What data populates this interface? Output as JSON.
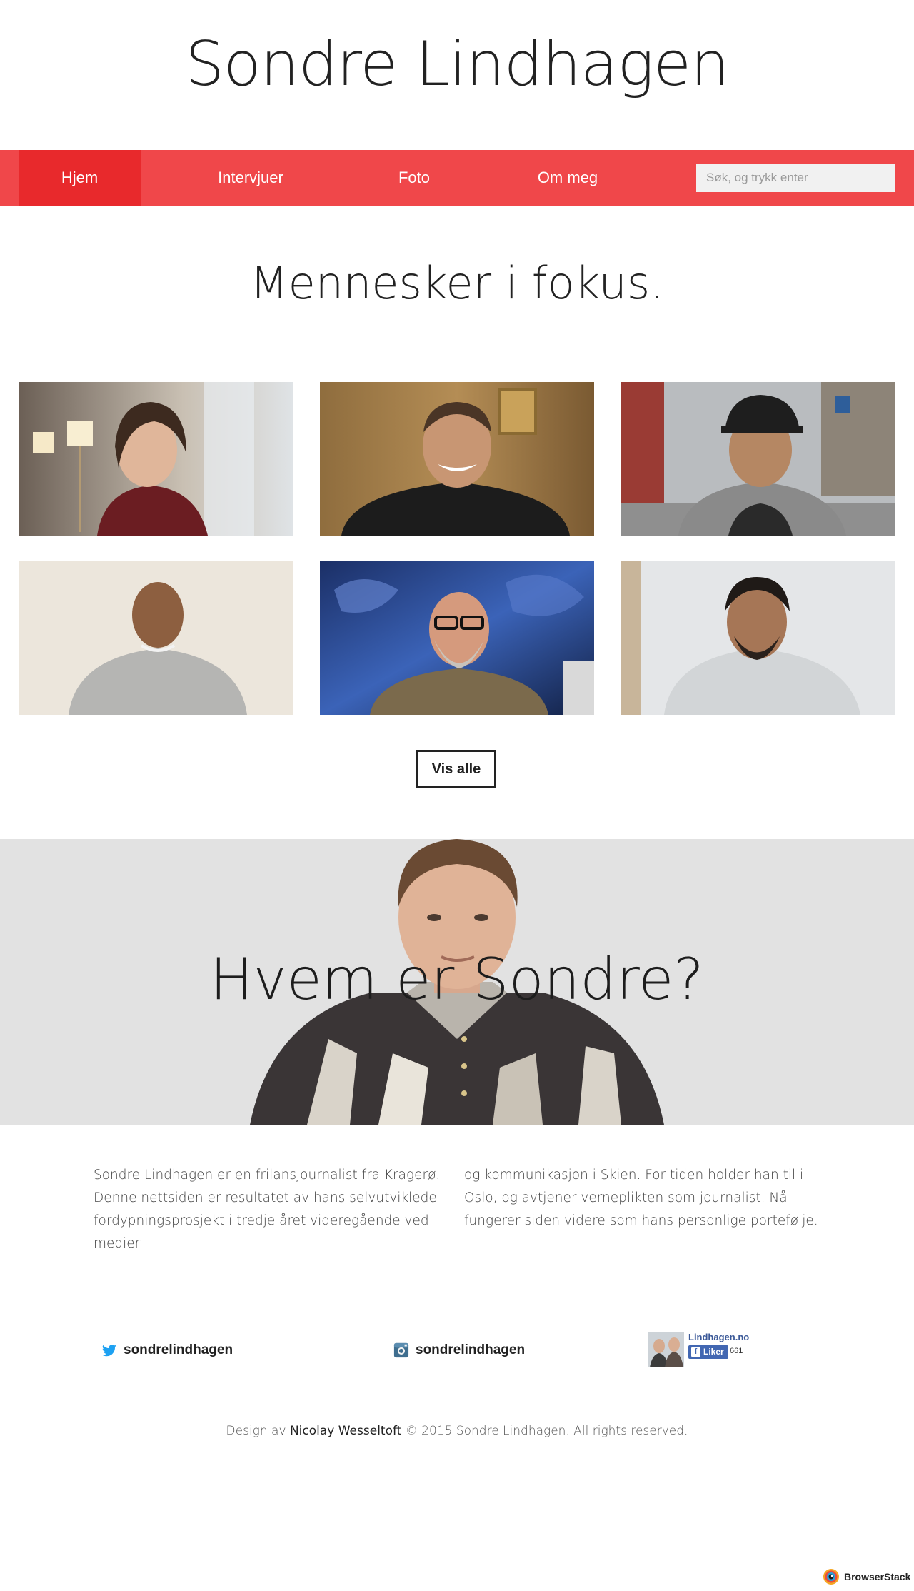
{
  "site": {
    "title": "Sondre Lindhagen"
  },
  "nav": {
    "items": [
      {
        "label": "Hjem",
        "active": true
      },
      {
        "label": "Intervjuer",
        "active": false
      },
      {
        "label": "Foto",
        "active": false
      },
      {
        "label": "Om meg",
        "active": false
      }
    ],
    "search_placeholder": "Søk, og trykk enter"
  },
  "focus": {
    "heading": "Mennesker i fokus.",
    "show_all_label": "Vis alle"
  },
  "hero": {
    "title": "Hvem er Sondre?"
  },
  "about": {
    "column_left": "Sondre Lindhagen er en frilansjournalist fra Kragerø. Denne nettsiden er resultatet av hans selvutviklede fordypningsprosjekt i tredje året videregående ved medier",
    "column_right": "og kommunikasjon i Skien. For tiden holder han til i Oslo, og avtjener verneplikten som journalist. Nå fungerer siden videre som hans personlige portefølje."
  },
  "social": {
    "twitter_handle": "sondrelindhagen",
    "instagram_handle": "sondrelindhagen",
    "facebook": {
      "page_name": "Lindhagen.no",
      "like_label": "Liker",
      "like_count": "661"
    }
  },
  "footer": {
    "prefix": "Design av",
    "author": "Nicolay Wesseltoft",
    "suffix": "© 2015 Sondre Lindhagen. All rights reserved."
  },
  "badge": {
    "label": "BrowserStack"
  },
  "colors": {
    "nav": "#f0474a",
    "nav_active": "#e8292c",
    "hero_bg": "#e2e2e2"
  }
}
